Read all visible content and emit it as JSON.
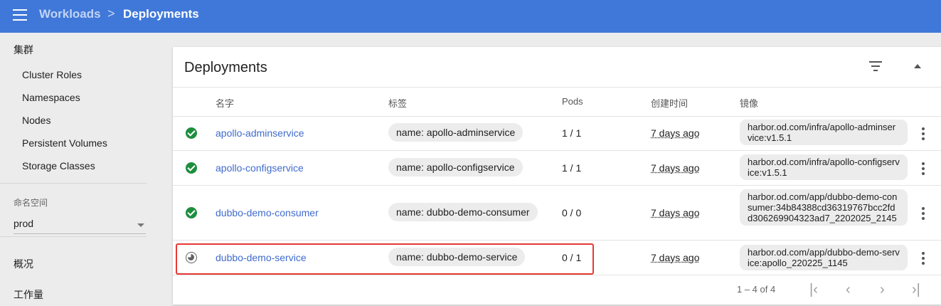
{
  "header": {
    "breadcrumb_parent": "Workloads",
    "breadcrumb_separator": ">",
    "breadcrumb_current": "Deployments"
  },
  "sidebar": {
    "cluster_heading": "集群",
    "cluster_items": [
      "Cluster Roles",
      "Namespaces",
      "Nodes",
      "Persistent Volumes",
      "Storage Classes"
    ],
    "namespace_label": "命名空间",
    "namespace_value": "prod",
    "overview": "概况",
    "workloads": "工作量"
  },
  "card": {
    "title": "Deployments",
    "columns": [
      "名字",
      "标签",
      "Pods",
      "创建时间",
      "镜像"
    ],
    "rows": [
      {
        "status": "ok",
        "name": "apollo-adminservice",
        "label": "name: apollo-adminservice",
        "pods": "1 / 1",
        "created": "7 days ago",
        "image": "harbor.od.com/infra/apollo-adminservice:v1.5.1"
      },
      {
        "status": "ok",
        "name": "apollo-configservice",
        "label": "name: apollo-configservice",
        "pods": "1 / 1",
        "created": "7 days ago",
        "image": "harbor.od.com/infra/apollo-configservice:v1.5.1"
      },
      {
        "status": "ok",
        "name": "dubbo-demo-consumer",
        "label": "name: dubbo-demo-consumer",
        "pods": "0 / 0",
        "created": "7 days ago",
        "image": "harbor.od.com/app/dubbo-demo-consumer:34b84388cd36319767bcc2fdd306269904323ad7_2202025_2145"
      },
      {
        "status": "pending",
        "name": "dubbo-demo-service",
        "label": "name: dubbo-demo-service",
        "pods": "0 / 1",
        "created": "7 days ago",
        "image": "harbor.od.com/app/dubbo-demo-service:apollo_220225_1145"
      }
    ],
    "pagination": "1 – 4 of 4"
  },
  "colors": {
    "topbar": "#3f78d9",
    "link": "#3f6bce",
    "status_ok": "#1e8e3e",
    "highlight": "#e53935"
  }
}
